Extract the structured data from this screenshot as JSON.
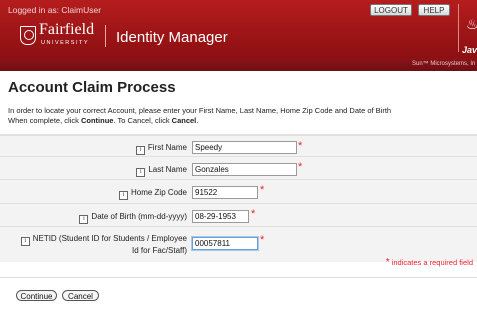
{
  "header": {
    "logged_in_text": "Logged in as: ClaimUser",
    "logout_label": "LOGOUT",
    "help_label": "HELP",
    "logo_name": "Fairfield",
    "logo_sub": "UNIVERSITY",
    "app_title": "Identity Manager",
    "java_text": "Java",
    "sun_text": "Sun™ Microsystems, In"
  },
  "page": {
    "title": "Account Claim Process",
    "intro_line1": "In order to locate your correct Account, please enter your First Name, Last Name, Home Zip Code and Date of Birth",
    "intro_line2_a": "When complete, click ",
    "intro_continue": "Continue",
    "intro_line2_b": ". To Cancel, click ",
    "intro_cancel": "Cancel",
    "intro_line2_c": "."
  },
  "form": {
    "first_name_label": "First Name",
    "first_name_value": "Speedy",
    "last_name_label": "Last Name",
    "last_name_value": "Gonzales",
    "zip_label": "Home Zip Code",
    "zip_value": "91522",
    "dob_label": "Date of Birth (mm-dd-yyyy)",
    "dob_value": "08-29-1953",
    "netid_label_1": "NETID (Student ID for Students / Employee",
    "netid_label_2": "Id for Fac/Staff)",
    "netid_value": "00057811",
    "info_icon": "i",
    "required_star": "*",
    "required_note": "indicates a required field"
  },
  "buttons": {
    "continue_label": "Continue",
    "cancel_label": "Cancel"
  },
  "colors": {
    "header_red": "#a5181b",
    "required_red": "#e22233"
  }
}
